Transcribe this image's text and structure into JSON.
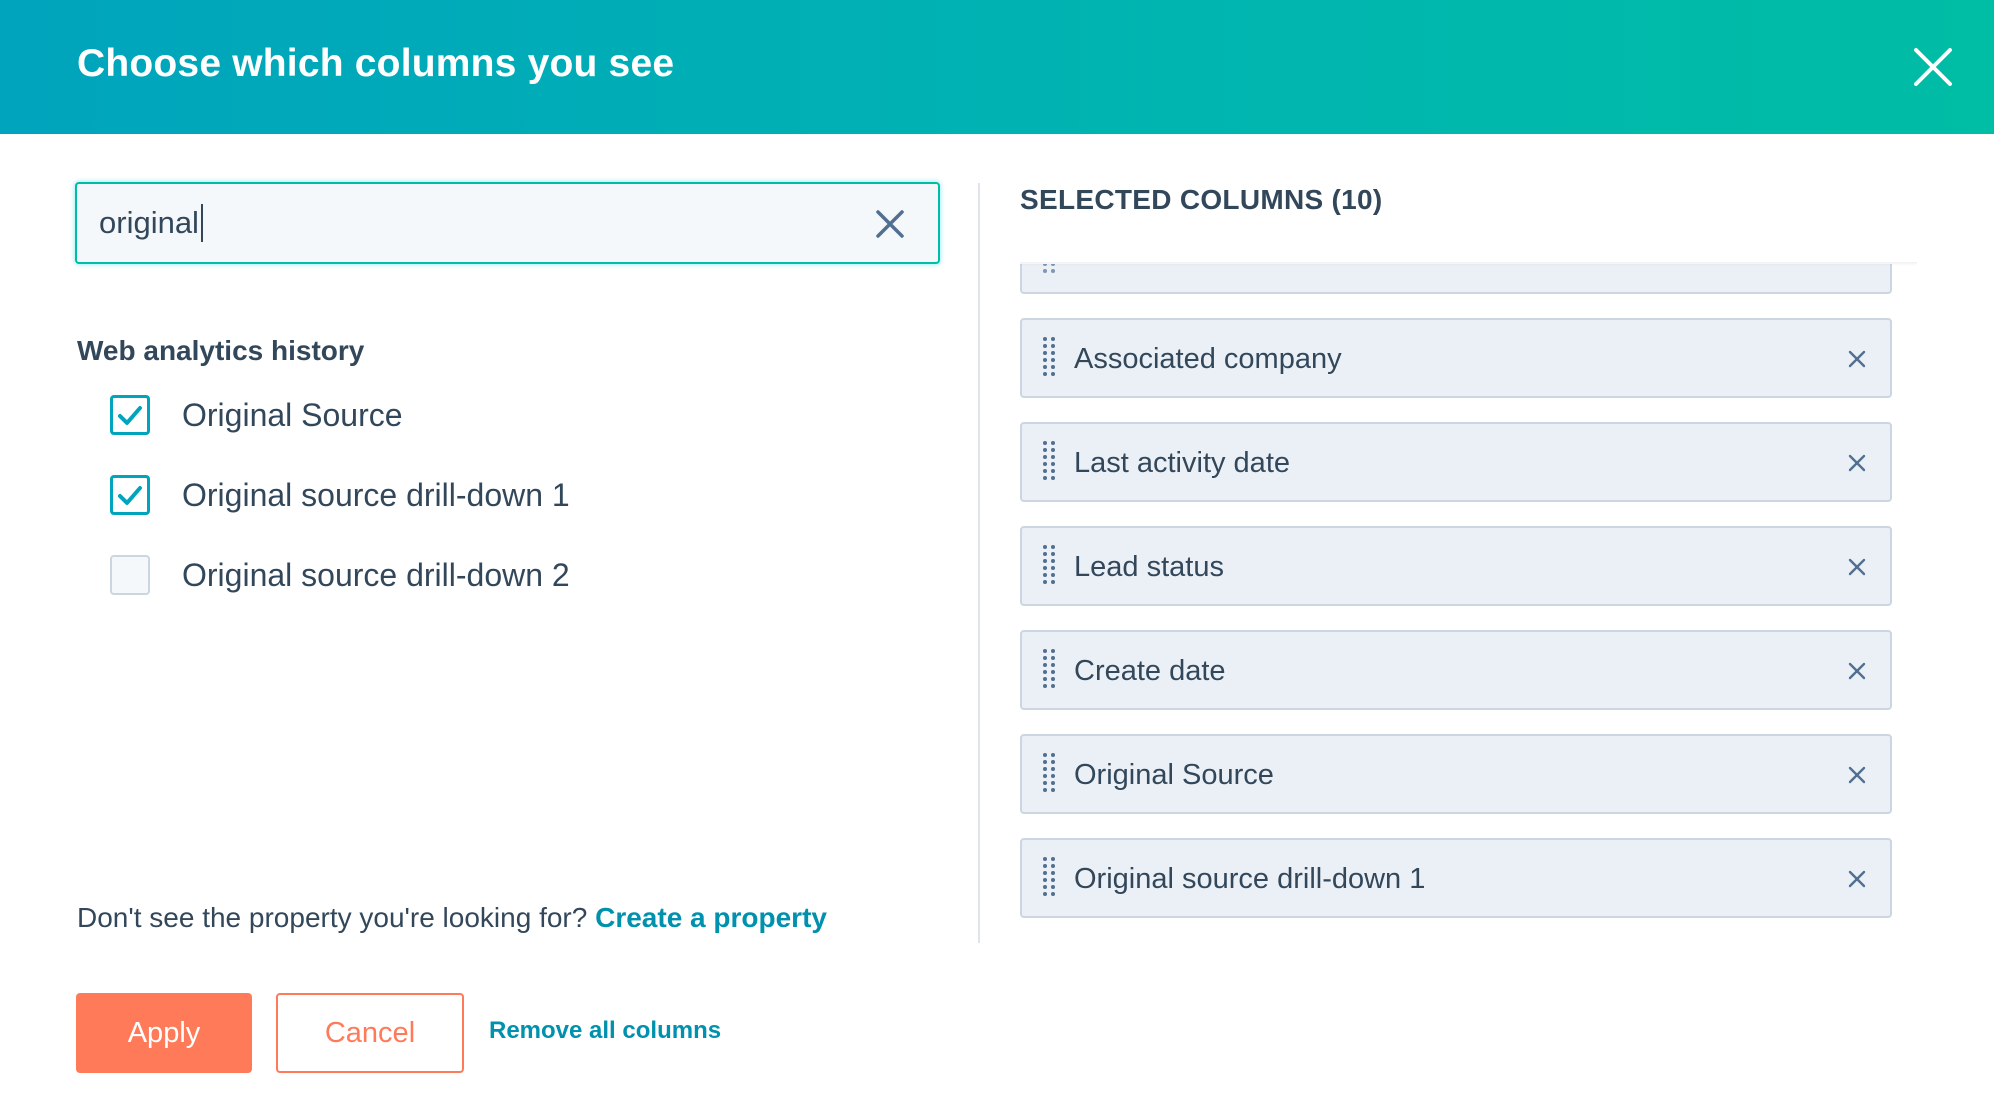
{
  "header": {
    "title": "Choose which columns you see",
    "close_icon": "close-icon"
  },
  "search": {
    "value": "original",
    "clear_icon": "close-icon"
  },
  "group": {
    "title": "Web analytics history",
    "items": [
      {
        "label": "Original Source",
        "checked": true
      },
      {
        "label": "Original source drill-down 1",
        "checked": true
      },
      {
        "label": "Original source drill-down 2",
        "checked": false
      }
    ]
  },
  "create_property": {
    "prompt": "Don't see the property you're looking for?",
    "link": "Create a property"
  },
  "selected": {
    "header": "SELECTED COLUMNS (10)",
    "items": [
      {
        "label": "Associated company"
      },
      {
        "label": "Last activity date"
      },
      {
        "label": "Lead status"
      },
      {
        "label": "Create date"
      },
      {
        "label": "Original Source"
      },
      {
        "label": "Original source drill-down 1"
      }
    ]
  },
  "footer": {
    "apply_label": "Apply",
    "cancel_label": "Cancel",
    "remove_all_label": "Remove all columns"
  },
  "colors": {
    "header_start": "#00a4bd",
    "header_end": "#00bda5",
    "primary": "#ff7a59",
    "link": "#0091ae",
    "text": "#33475b",
    "item_bg": "#eaf0f6"
  }
}
